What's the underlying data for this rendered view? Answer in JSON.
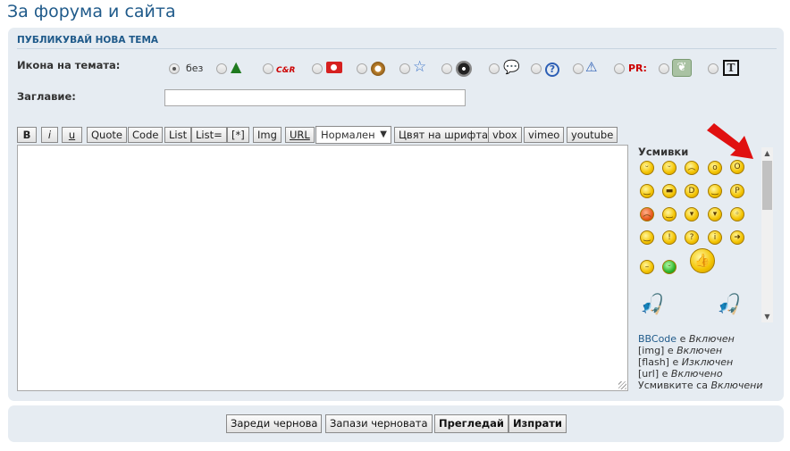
{
  "page": {
    "title": "За форума и сайта"
  },
  "form": {
    "header": "ПУБЛИКУВАЙ НОВА ТЕМА",
    "icon_label": "Икона на темата:",
    "icon_none_label": "без",
    "icon_cr_text": "C&R",
    "icon_pr_text": "PR:",
    "title_label": "Заглавие:",
    "title_value": ""
  },
  "icons": [
    "none",
    "tree-icon",
    "cr-icon",
    "camera-icon",
    "badge-icon",
    "star-icon",
    "film-reel-icon",
    "speech-bubble-icon",
    "question-icon",
    "warning-icon",
    "pr-icon",
    "leaf-icon",
    "text-t-icon"
  ],
  "toolbar": {
    "bold": "B",
    "italic": "i",
    "underline": "u",
    "quote": "Quote",
    "code": "Code",
    "list": "List",
    "list_eq": "List=",
    "list_item": "[*]",
    "img": "Img",
    "url": "URL",
    "size_selected": "Нормален",
    "font_color": "Цвят на шрифта",
    "vbox": "vbox",
    "vimeo": "vimeo",
    "youtube": "youtube"
  },
  "message": {
    "value": ""
  },
  "smilies": {
    "title": "Усмивки"
  },
  "bbcode_status": {
    "bbcode_link": "BBCode",
    "bbcode_is": "е",
    "bbcode_state": "Включен",
    "img_tag": "[img]",
    "img_is": "е",
    "img_state": "Включен",
    "flash_tag": "[flash]",
    "flash_is": "е",
    "flash_state": "Изключен",
    "url_tag": "[url]",
    "url_is": "е",
    "url_state": "Включено",
    "smilies_text": "Усмивките са",
    "smilies_state": "Включени"
  },
  "actions": {
    "load_draft": "Зареди чернова",
    "save_draft": "Запази черновата",
    "preview": "Прегледай",
    "submit": "Изпрати"
  },
  "colors": {
    "accent": "#1f5a8a",
    "panel_bg": "#e6ecf2",
    "arrow_red": "#e01010"
  }
}
